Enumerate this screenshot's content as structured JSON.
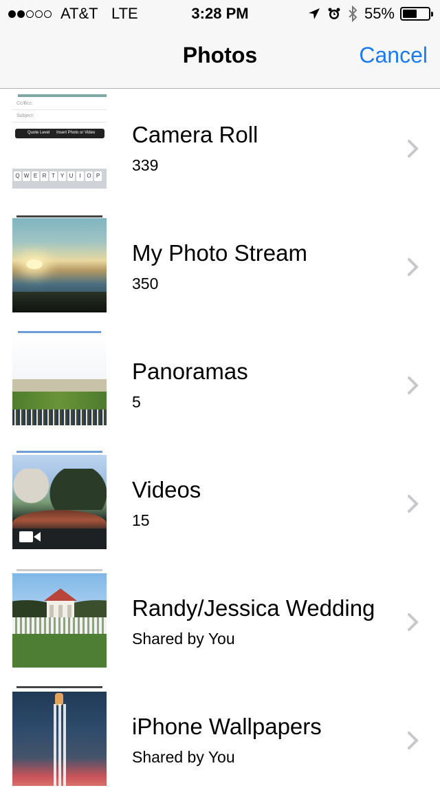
{
  "status_bar": {
    "carrier": "AT&T",
    "network": "LTE",
    "time": "3:28 PM",
    "battery_percent_text": "55%",
    "battery_level": 0.55,
    "signal_bars_filled": 2,
    "signal_bars_total": 5
  },
  "nav": {
    "title": "Photos",
    "cancel_label": "Cancel",
    "accent_color": "#1a7cf5"
  },
  "albums": [
    {
      "title": "Camera Roll",
      "subtitle": "339"
    },
    {
      "title": "My Photo Stream",
      "subtitle": "350"
    },
    {
      "title": "Panoramas",
      "subtitle": "5"
    },
    {
      "title": "Videos",
      "subtitle": "15"
    },
    {
      "title": "Randy/Jessica Wedding",
      "subtitle": "Shared by You"
    },
    {
      "title": "iPhone Wallpapers",
      "subtitle": "Shared by You"
    }
  ],
  "camera_roll_thumb": {
    "fields": [
      "Cc/Bcc:",
      "Subject:"
    ],
    "popup_items": [
      "Quote Level",
      "Insert Photo or Video"
    ],
    "keyboard_row1": [
      "Q",
      "W",
      "E",
      "R",
      "T",
      "Y",
      "U",
      "I",
      "O",
      "P"
    ]
  }
}
